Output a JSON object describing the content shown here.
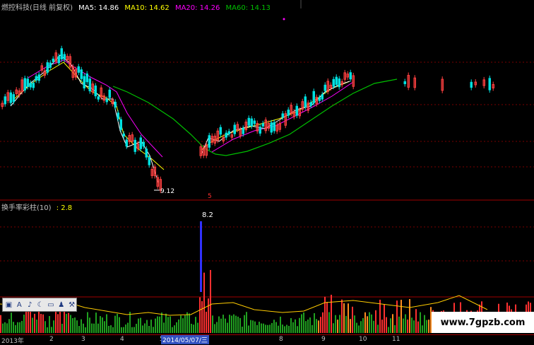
{
  "header": {
    "stock": "燃控科技(日线 前复权)",
    "ma5": "MA5: 14.86",
    "ma10": "MA10: 14.62",
    "ma20": "MA20: 14.26",
    "ma60": "MA60: 14.13",
    "colors": {
      "ma5": "#ffffff",
      "ma10": "#ffff00",
      "ma20": "#ff00ff",
      "ma60": "#00c000"
    }
  },
  "annotations": {
    "low": "9.12",
    "peak": "8.2",
    "marker": "5"
  },
  "subpanel": {
    "indicator": "换手率彩柱(10)",
    "value": ": 2.8"
  },
  "xaxis": {
    "ticks": [
      "2013年",
      "2",
      "3",
      "4",
      "5",
      "8",
      "9",
      "10",
      "11"
    ],
    "selected": "2014/05/07/三"
  },
  "toolbar": {
    "icons": [
      "window-icon",
      "text-icon",
      "draw-icon",
      "moon-icon",
      "keyboard-icon",
      "person-icon",
      "wrench-icon"
    ]
  },
  "watermark": "www.7gpzb.com"
}
